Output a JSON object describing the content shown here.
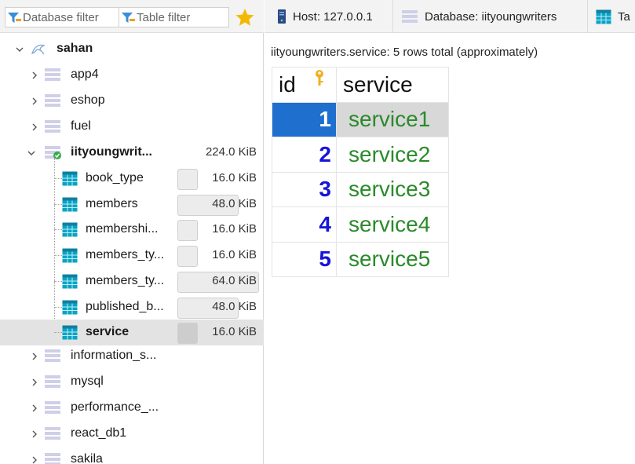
{
  "left_toolbar": {
    "database_filter_placeholder": "Database filter",
    "table_filter_placeholder": "Table filter",
    "favorite_icon": "star-icon"
  },
  "tree": {
    "session": {
      "name": "sahan",
      "icon": "dolphin-icon"
    },
    "databases_before": [
      {
        "name": "app4"
      },
      {
        "name": "eshop"
      },
      {
        "name": "fuel"
      }
    ],
    "active_db": {
      "name": "iityoungwrit...",
      "size": "224.0 KiB",
      "tables": [
        {
          "name": "book_type",
          "size": "16.0 KiB",
          "fill": 0.25
        },
        {
          "name": "members",
          "size": "48.0 KiB",
          "fill": 0.75
        },
        {
          "name": "membershi...",
          "size": "16.0 KiB",
          "fill": 0.25
        },
        {
          "name": "members_ty...",
          "size": "16.0 KiB",
          "fill": 0.25
        },
        {
          "name": "members_ty...",
          "size": "64.0 KiB",
          "fill": 1.0
        },
        {
          "name": "published_b...",
          "size": "48.0 KiB",
          "fill": 0.75
        },
        {
          "name": "service",
          "size": "16.0 KiB",
          "fill": 0.25,
          "selected": true
        }
      ]
    },
    "databases_after": [
      {
        "name": "information_s..."
      },
      {
        "name": "mysql"
      },
      {
        "name": "performance_..."
      },
      {
        "name": "react_db1"
      },
      {
        "name": "sakila"
      }
    ]
  },
  "tabs": {
    "host": "Host: 127.0.0.1",
    "database": "Database: iityoungwriters",
    "table": "Ta"
  },
  "grid": {
    "info": "iityoungwriters.service: 5 rows total (approximately)",
    "columns": [
      "id",
      "service"
    ],
    "rows": [
      {
        "id": "1",
        "service": "service1"
      },
      {
        "id": "2",
        "service": "service2"
      },
      {
        "id": "3",
        "service": "service3"
      },
      {
        "id": "4",
        "service": "service4"
      },
      {
        "id": "5",
        "service": "service5"
      }
    ]
  },
  "colors": {
    "selection_blue": "#1f6fcf",
    "id_blue": "#1515d8",
    "text_green": "#2a8a2a",
    "table_icon_teal": "#0aa3c2"
  }
}
